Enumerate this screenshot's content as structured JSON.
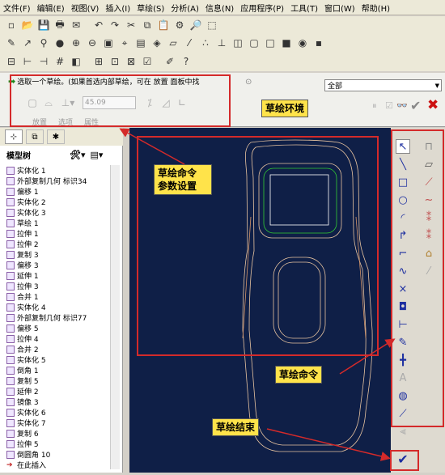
{
  "menu": [
    "文件(F)",
    "编辑(E)",
    "视图(V)",
    "插入(I)",
    "草绘(S)",
    "分析(A)",
    "信息(N)",
    "应用程序(P)",
    "工具(T)",
    "窗口(W)",
    "帮助(H)"
  ],
  "dashboard": {
    "prompt": "选取一个草绘。(如果首选内部草绘，可在 放置 面板中找",
    "filter_value": "全部",
    "depth_value": "45.09",
    "tabs": [
      "放置",
      "选项",
      "属性"
    ]
  },
  "tree": {
    "title": "模型树",
    "items": [
      "实体化 1",
      "外部复制几何 标识34",
      "偏移 1",
      "实体化 2",
      "实体化 3",
      "草绘 1",
      "拉伸 1",
      "拉伸 2",
      "复制 3",
      "偏移 3",
      "延伸 1",
      "拉伸 3",
      "合并 1",
      "实体化 4",
      "外部复制几何 标识77",
      "偏移 5",
      "拉伸 4",
      "合并 2",
      "实体化 5",
      "倒角 1",
      "复制 5",
      "延伸 2",
      "镜像 3",
      "实体化 6",
      "实体化 7",
      "复制 6",
      "拉伸 5",
      "倒圆角 10",
      "在此插入"
    ]
  },
  "callouts": {
    "sketch_env": "草绘环境",
    "params": "草绘命令\n参数设置",
    "commands": "草绘命令",
    "end": "草绘结束"
  },
  "colors": {
    "accent": "#d42a2a",
    "callout": "#ffe34a",
    "canvas": "#0f1f47"
  }
}
